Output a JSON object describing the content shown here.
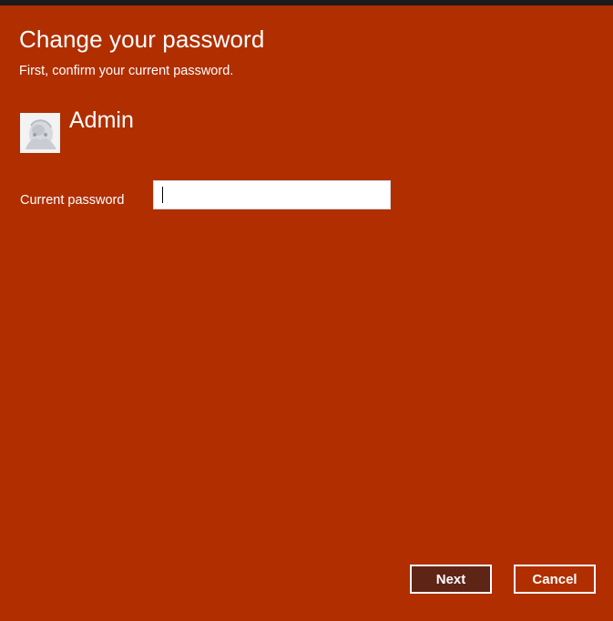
{
  "dialog": {
    "title": "Change your password",
    "subtitle": "First, confirm your current password."
  },
  "user": {
    "name": "Admin",
    "avatar_icon": "user-avatar-image"
  },
  "form": {
    "current_password_label": "Current password",
    "current_password_value": ""
  },
  "buttons": {
    "next_label": "Next",
    "cancel_label": "Cancel"
  },
  "colors": {
    "background": "#b02e00",
    "top_bar": "#1b1b1b",
    "primary_button_fill": "#5e2416",
    "text": "#ffffff"
  }
}
